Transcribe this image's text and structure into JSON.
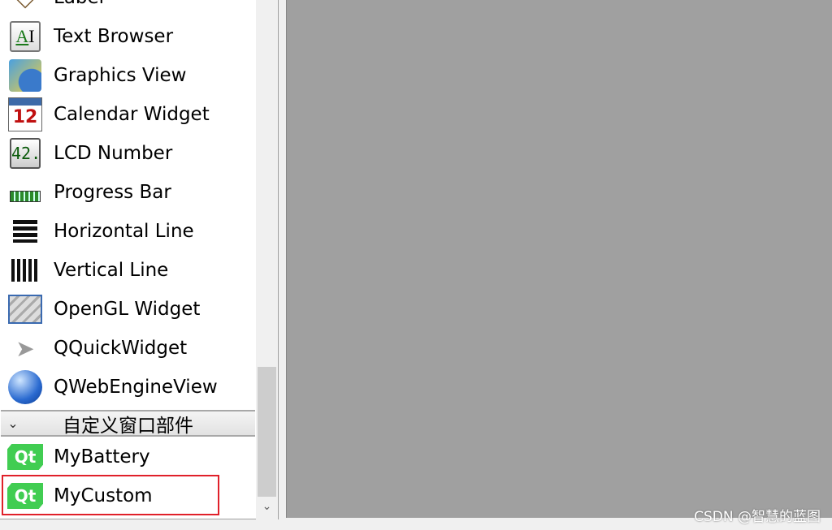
{
  "widgets": [
    {
      "label": "Label",
      "icon": "label-icon"
    },
    {
      "label": "Text Browser",
      "icon": "text-browser-icon"
    },
    {
      "label": "Graphics View",
      "icon": "graphics-view-icon"
    },
    {
      "label": "Calendar Widget",
      "icon": "calendar-icon"
    },
    {
      "label": "LCD Number",
      "icon": "lcd-number-icon"
    },
    {
      "label": "Progress Bar",
      "icon": "progress-bar-icon"
    },
    {
      "label": "Horizontal Line",
      "icon": "horizontal-line-icon"
    },
    {
      "label": "Vertical Line",
      "icon": "vertical-line-icon"
    },
    {
      "label": "OpenGL Widget",
      "icon": "opengl-icon"
    },
    {
      "label": "QQuickWidget",
      "icon": "paper-plane-icon"
    },
    {
      "label": "QWebEngineView",
      "icon": "globe-icon"
    }
  ],
  "category": {
    "label": "自定义窗口部件"
  },
  "custom": [
    {
      "label": "MyBattery",
      "icon": "qt-logo-icon",
      "badge": "Qt"
    },
    {
      "label": "MyCustom",
      "icon": "qt-logo-icon",
      "badge": "Qt",
      "highlighted": true
    }
  ],
  "highlight_color": "#e0202a",
  "watermark": "CSDN @智慧的蓝图"
}
